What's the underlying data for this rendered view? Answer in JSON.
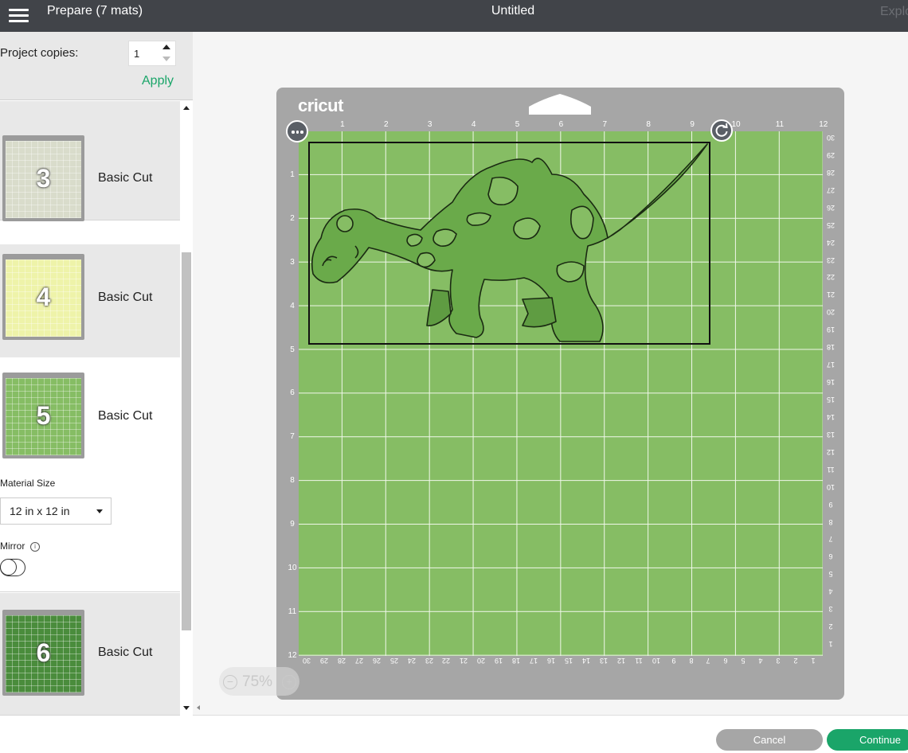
{
  "header": {
    "title": "Prepare (7 mats)",
    "document_title": "Untitled",
    "explore_label": "Explo"
  },
  "project_copies": {
    "label": "Project copies:",
    "value": "1",
    "apply_label": "Apply"
  },
  "mats": [
    {
      "number": "3",
      "label": "Basic Cut",
      "color": "#d9dccb"
    },
    {
      "number": "4",
      "label": "Basic Cut",
      "color": "#eef3a9"
    },
    {
      "number": "5",
      "label": "Basic Cut",
      "color": "#86bd64",
      "selected": true
    },
    {
      "number": "6",
      "label": "Basic Cut",
      "color": "#4a8c3c"
    }
  ],
  "mat_settings": {
    "material_size_label": "Material Size",
    "material_size_value": "12 in x 12 in",
    "mirror_label": "Mirror",
    "mirror_on": false
  },
  "canvas": {
    "brand": "cricut",
    "mat_color": "#86bd64",
    "ruler_top": [
      "1",
      "2",
      "3",
      "4",
      "5",
      "6",
      "7",
      "8",
      "9",
      "10",
      "11",
      "12"
    ],
    "ruler_left": [
      "1",
      "2",
      "3",
      "4",
      "5",
      "6",
      "7",
      "8",
      "9",
      "10",
      "11",
      "12"
    ],
    "ruler_right": [
      "30",
      "29",
      "28",
      "27",
      "26",
      "25",
      "24",
      "23",
      "22",
      "21",
      "20",
      "19",
      "18",
      "17",
      "16",
      "15",
      "14",
      "13",
      "12",
      "11",
      "10",
      "9",
      "8",
      "7",
      "6",
      "5",
      "4",
      "3",
      "2",
      "1"
    ],
    "ruler_bottom": [
      "30",
      "29",
      "28",
      "27",
      "26",
      "25",
      "24",
      "23",
      "22",
      "21",
      "20",
      "19",
      "18",
      "17",
      "16",
      "15",
      "14",
      "13",
      "12",
      "11",
      "10",
      "9",
      "8",
      "7",
      "6",
      "5",
      "4",
      "3",
      "2",
      "1"
    ],
    "zoom": "75%"
  },
  "footer": {
    "cancel_label": "Cancel",
    "continue_label": "Continue",
    "accent": "#1aa569"
  }
}
